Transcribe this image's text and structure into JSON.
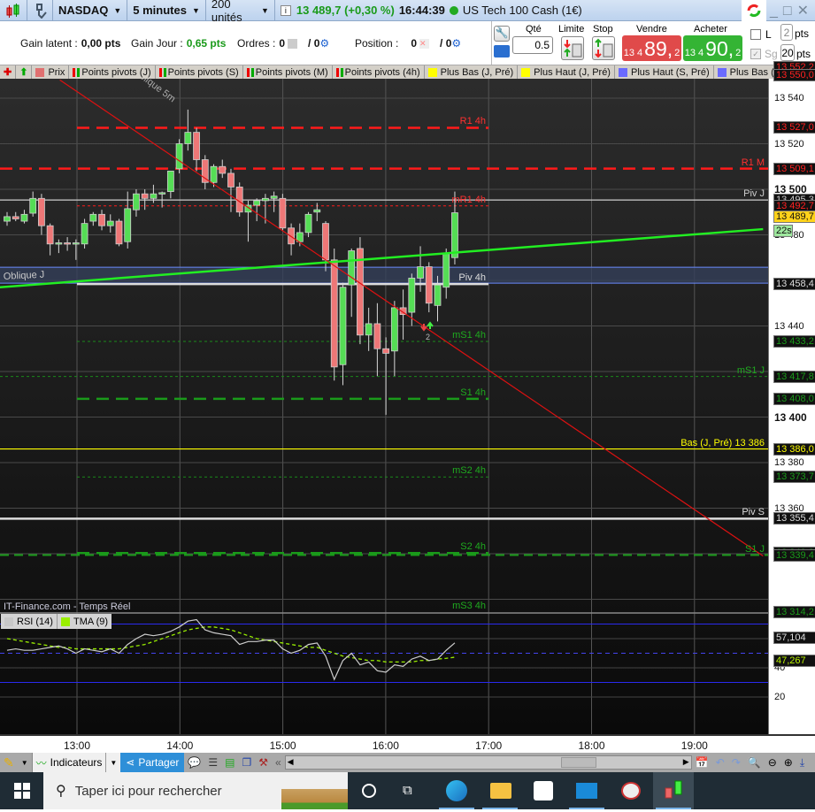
{
  "titlebar": {
    "instrument": "NASDAQ",
    "timeframe": "5 minutes",
    "units": "200 unités",
    "last_price": "13 489,7 (+0,30 %)",
    "time": "16:44:39",
    "instrument_name": "US Tech 100 Cash (1€)"
  },
  "infobar": {
    "gain_latent_label": "Gain latent :",
    "gain_latent_value": "0,00 pts",
    "gain_jour_label": "Gain Jour :",
    "gain_jour_value": "0,65 pts",
    "ordres_label": "Ordres :",
    "ordres_value": "0",
    "ordres_value2": "/ 0",
    "position_label": "Position :",
    "position_value": "0",
    "position_value2": "/ 0"
  },
  "trade": {
    "qty_label": "Qté",
    "qty_value": "0.5",
    "limite_label": "Limite",
    "stop_label": "Stop",
    "sell_label": "Vendre",
    "sell_small": "13 4",
    "sell_big": "89,",
    "sell_sup": "2",
    "buy_label": "Acheter",
    "buy_small": "13 4",
    "buy_big": "90,",
    "buy_sup": "2",
    "l_label": "L",
    "sg_label": "Sg",
    "pts1_value": "2",
    "pts2_value": "20",
    "pts_label": "pts"
  },
  "legend": [
    {
      "label": "Prix",
      "color": "#e07070"
    },
    {
      "label": "Points pivots (J)"
    },
    {
      "label": "Points pivots (S)"
    },
    {
      "label": "Points pivots (M)"
    },
    {
      "label": "Points pivots (4h)"
    },
    {
      "label": "Plus Bas (J, Pré)",
      "color": "#ffff00"
    },
    {
      "label": "Plus Haut (J, Pré)",
      "color": "#ffff00"
    },
    {
      "label": "Plus Haut (S, Pré)",
      "color": "#6a6aff"
    },
    {
      "label": "Plus Bas (S, Pré)",
      "color": "#6a6aff"
    }
  ],
  "chart_data": {
    "type": "candlestick",
    "instrument": "NASDAQ",
    "timeframe": "5 minutes",
    "ylim": [
      13290,
      13565
    ],
    "first_candle_time": "12:20",
    "candles": [
      [
        13486,
        13490,
        13484,
        13488
      ],
      [
        13488,
        13490,
        13486,
        13487
      ],
      [
        13486,
        13491,
        13485,
        13489
      ],
      [
        13489.5,
        13499,
        13488,
        13496
      ],
      [
        13496,
        13498,
        13480,
        13484
      ],
      [
        13484,
        13485,
        13471,
        13476
      ],
      [
        13476,
        13478,
        13472,
        13476.5
      ],
      [
        13476.5,
        13479,
        13473,
        13476
      ],
      [
        13476,
        13478,
        13469,
        13476.5
      ],
      [
        13476,
        13487,
        13474,
        13485
      ],
      [
        13486,
        13490,
        13484,
        13489
      ],
      [
        13489,
        13491,
        13482,
        13484
      ],
      [
        13484,
        13489,
        13481,
        13486
      ],
      [
        13486,
        13487,
        13475,
        13476
      ],
      [
        13477,
        13499,
        13474,
        13491.5
      ],
      [
        13491,
        13500,
        13488,
        13498
      ],
      [
        13498,
        13500,
        13491,
        13496
      ],
      [
        13496,
        13502,
        13494,
        13498
      ],
      [
        13498,
        13499,
        13492,
        13498.5
      ],
      [
        13499,
        13508,
        13496,
        13508
      ],
      [
        13509,
        13522,
        13507,
        13520
      ],
      [
        13520,
        13535,
        13517,
        13525
      ],
      [
        13525,
        13527,
        13508,
        13513
      ],
      [
        13513,
        13515,
        13500,
        13503
      ],
      [
        13503,
        13511,
        13501,
        13510
      ],
      [
        13510,
        13513,
        13505,
        13507
      ],
      [
        13507,
        13509,
        13490,
        13501
      ],
      [
        13501,
        13503,
        13488,
        13490
      ],
      [
        13490,
        13495,
        13477,
        13493
      ],
      [
        13493,
        13496,
        13486,
        13495
      ],
      [
        13495,
        13498,
        13485,
        13496
      ],
      [
        13496,
        13499,
        13490,
        13497
      ],
      [
        13496,
        13498,
        13482,
        13483
      ],
      [
        13483,
        13485,
        13471,
        13476
      ],
      [
        13477,
        13485,
        13475,
        13481
      ],
      [
        13481,
        13490,
        13479,
        13489
      ],
      [
        13490,
        13494,
        13486,
        13491
      ],
      [
        13485,
        13486,
        13464,
        13469
      ],
      [
        13469,
        13474,
        13416,
        13422
      ],
      [
        13423,
        13459,
        13414,
        13457
      ],
      [
        13458,
        13474,
        13444,
        13473
      ],
      [
        13474,
        13479,
        13432,
        13436
      ],
      [
        13436,
        13448,
        13429,
        13441
      ],
      [
        13441,
        13450,
        13418,
        13430
      ],
      [
        13430,
        13435,
        13401,
        13428
      ],
      [
        13429,
        13451,
        13418,
        13448
      ],
      [
        13448,
        13456,
        13434,
        13445
      ],
      [
        13446,
        13463,
        13440,
        13461
      ],
      [
        13461,
        13475,
        13455,
        13466
      ],
      [
        13466,
        13468,
        13446,
        13450
      ],
      [
        13449,
        13462,
        13442,
        13458
      ],
      [
        13457,
        13474,
        13452,
        13472
      ],
      [
        13470,
        13499,
        13467,
        13489.7
      ]
    ],
    "levels": [
      {
        "label": "R1 4h",
        "price": 13527.0,
        "color": "#ff1a1a",
        "style": "dash-thick",
        "scope": "4h"
      },
      {
        "label": "R1 M",
        "price": 13509.1,
        "color": "#ff1a1a",
        "style": "dash-thick",
        "scope": "full"
      },
      {
        "label": "Piv J",
        "price": 13495.3,
        "color": "#cccccc",
        "style": "solid",
        "scope": "full"
      },
      {
        "label": "mR1 4h",
        "price": 13492.7,
        "color": "#ff1a1a",
        "style": "dot",
        "scope": "4h"
      },
      {
        "label": "Piv 4h",
        "price": 13458.4,
        "color": "#dddddd",
        "style": "solid-thick",
        "scope": "4h"
      },
      {
        "label": "mS1 4h",
        "price": 13433.2,
        "color": "#1a8a1a",
        "style": "dot",
        "scope": "4h"
      },
      {
        "label": "mS1 J",
        "price": 13417.8,
        "color": "#1a8a1a",
        "style": "dot",
        "scope": "full"
      },
      {
        "label": "S1 4h",
        "price": 13408.0,
        "color": "#1a9a1a",
        "style": "dash-thick",
        "scope": "4h"
      },
      {
        "label": "Bas (J, Pré) 13 386",
        "price": 13386.0,
        "color": "#ffff00",
        "style": "solid",
        "scope": "full"
      },
      {
        "label": "mS2 4h",
        "price": 13373.7,
        "color": "#1a8a1a",
        "style": "dot",
        "scope": "4h"
      },
      {
        "label": "Piv S",
        "price": 13355.4,
        "color": "#dddddd",
        "style": "solid-thick",
        "scope": "full"
      },
      {
        "label": "S2 4h",
        "price": 13340.3,
        "color": "#1a9a1a",
        "style": "dash-thick",
        "scope": "4h"
      },
      {
        "label": "S1 J",
        "price": 13339.4,
        "color": "#1a9a1a",
        "style": "dash",
        "scope": "full"
      },
      {
        "label": "mS3 4h",
        "price": 13314.2,
        "color": "#1a8a1a",
        "style": "dot",
        "scope": "4h"
      }
    ],
    "band": {
      "from": 13458.8,
      "to": 13465.8,
      "color": "#6a8aff"
    },
    "trendlines": [
      {
        "label": "Oblique J",
        "color": "#22ee22",
        "from": [
          "12:15",
          13457
        ],
        "to": [
          "19:40",
          13482.5
        ]
      },
      {
        "label": "Oblique 5m",
        "color": "#dd1111",
        "from": [
          "12:50",
          13548
        ],
        "to": [
          "19:40",
          13339
        ]
      }
    ],
    "marker_count": "2",
    "price_ticks": [
      {
        "v": 13540,
        "t": "13 540"
      },
      {
        "v": 13520,
        "t": "13 520"
      },
      {
        "v": 13500,
        "t": "13 500",
        "bold": true
      },
      {
        "v": 13480,
        "t": "13 480"
      },
      {
        "v": 13440,
        "t": "13 440"
      },
      {
        "v": 13400,
        "t": "13 400",
        "bold": true
      },
      {
        "v": 13380,
        "t": "13 380"
      },
      {
        "v": 13360,
        "t": "13 360"
      }
    ],
    "price_boxes": [
      {
        "v": 13552.2,
        "t": "13 552,2",
        "c": "#ff2020"
      },
      {
        "v": 13550.0,
        "t": "13 550,0",
        "c": "#ff2020"
      },
      {
        "v": 13527.0,
        "t": "13 527,0",
        "c": "#ff2020"
      },
      {
        "v": 13509.1,
        "t": "13 509,1",
        "c": "#ff2020"
      },
      {
        "v": 13495.3,
        "t": "13 495,3",
        "c": "#cccccc"
      },
      {
        "v": 13492.7,
        "t": "13 492,7",
        "c": "#ff2020"
      },
      {
        "v": 13458.4,
        "t": "13 458,4",
        "c": "#dddddd"
      },
      {
        "v": 13433.2,
        "t": "13 433,2",
        "c": "#1a9a1a"
      },
      {
        "v": 13417.8,
        "t": "13 417,8",
        "c": "#1a9a1a"
      },
      {
        "v": 13408.0,
        "t": "13 408,0",
        "c": "#1a9a1a"
      },
      {
        "v": 13386.0,
        "t": "13 386,0",
        "c": "#ffff00"
      },
      {
        "v": 13373.7,
        "t": "13 373,7",
        "c": "#1a9a1a"
      },
      {
        "v": 13355.4,
        "t": "13 355,4",
        "c": "#dddddd"
      },
      {
        "v": 13340.3,
        "t": "13 340,3",
        "c": "#1a9a1a"
      },
      {
        "v": 13339.4,
        "t": "13 339,4",
        "c": "#1a9a1a"
      },
      {
        "v": 13314.2,
        "t": "13 314,2",
        "c": "#1a9a1a"
      }
    ],
    "current_price": {
      "v": 13489.7,
      "t": "13 489,7"
    },
    "countdown": "22s",
    "source_label": "IT-Finance.com - Temps Réel",
    "time_ticks": [
      "13:00",
      "14:00",
      "15:00",
      "16:00",
      "17:00",
      "18:00",
      "19:00"
    ],
    "rsi": {
      "legend_rsi": "RSI (14)",
      "legend_tma": "TMA (9)",
      "rsi_color": "#cccccc",
      "tma_color": "#99ee00",
      "ylim": [
        0,
        100
      ],
      "levels": [
        70,
        50,
        30
      ],
      "ticks": [
        {
          "v": 60,
          "t": "60"
        },
        {
          "v": 40,
          "t": "40"
        },
        {
          "v": 20,
          "t": "20"
        }
      ],
      "rsi_values": [
        52,
        53,
        52,
        52,
        53,
        54,
        55,
        53,
        50,
        53,
        52,
        51,
        53,
        50,
        56,
        60,
        63,
        62,
        63,
        65,
        68,
        72,
        73,
        66,
        64,
        63,
        62,
        56,
        58,
        58,
        59,
        59,
        53,
        50,
        52,
        56,
        57,
        48,
        32,
        45,
        50,
        42,
        44,
        38,
        37,
        42,
        41,
        46,
        48,
        45,
        46,
        52,
        57.1
      ],
      "tma_values": [
        60,
        59,
        58,
        57,
        56,
        55,
        54,
        54,
        53,
        53,
        53,
        53,
        53,
        53,
        54,
        55,
        56,
        58,
        60,
        62,
        64,
        66,
        67,
        68,
        68,
        67,
        66,
        64,
        62,
        60,
        59,
        58,
        57,
        56,
        55,
        54,
        54,
        52,
        50,
        48,
        47,
        46,
        45,
        45,
        44,
        44,
        44,
        44,
        45,
        45,
        46,
        46.5,
        47.3
      ],
      "rsi_box": "57,104",
      "tma_box": "47,267"
    }
  },
  "toolbar": {
    "indicators_label": "Indicateurs",
    "share_label": "Partager"
  },
  "taskbar": {
    "search_placeholder": "Taper ici pour rechercher"
  }
}
